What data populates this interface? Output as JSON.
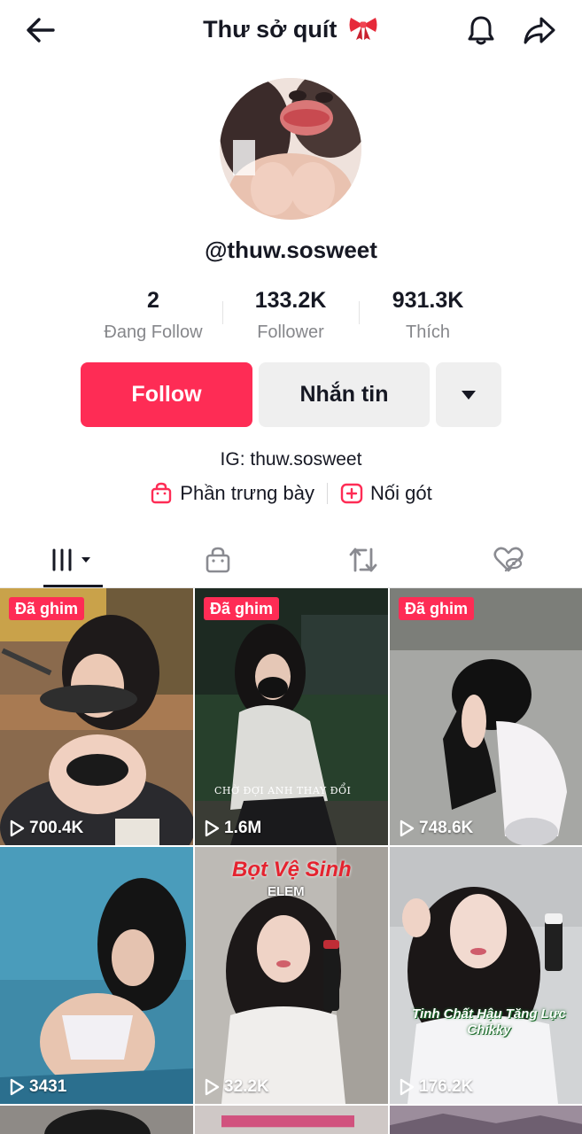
{
  "header": {
    "title": "Thư sở quít",
    "back_icon": "arrow-left-icon",
    "bell_icon": "bell-icon",
    "share_icon": "share-arrow-icon",
    "title_emoji": "ribbon-bow-icon"
  },
  "profile": {
    "username": "@thuw.sosweet",
    "stats": [
      {
        "value": "2",
        "label": "Đang Follow"
      },
      {
        "value": "133.2K",
        "label": "Follower"
      },
      {
        "value": "931.3K",
        "label": "Thích"
      }
    ],
    "follow_label": "Follow",
    "message_label": "Nhắn tin",
    "bio": "IG: thuw.sosweet",
    "links": [
      {
        "label": "Phần trưng bày",
        "icon": "shopping-bag-icon"
      },
      {
        "label": "Nối gót",
        "icon": "plus-square-icon"
      }
    ]
  },
  "tabs": [
    {
      "name": "videos",
      "icon": "grid-bars-icon",
      "active": true
    },
    {
      "name": "shop",
      "icon": "bag-icon",
      "active": false
    },
    {
      "name": "reposts",
      "icon": "repost-icon",
      "active": false
    },
    {
      "name": "liked",
      "icon": "heart-hidden-icon",
      "active": false
    }
  ],
  "videos": [
    {
      "pinned": "Đã ghim",
      "views": "700.4K"
    },
    {
      "pinned": "Đã ghim",
      "views": "1.6M",
      "caption": "CHỜ ĐỢI ANH THAY ĐỔI"
    },
    {
      "pinned": "Đã ghim",
      "views": "748.6K"
    },
    {
      "views": "3431"
    },
    {
      "views": "32.2K",
      "caption_top": "Bọt Vệ Sinh",
      "caption_sub": "ELEM"
    },
    {
      "views": "176.2K",
      "caption": "Tinh Chất Hậu Tăng Lực Chikky"
    }
  ],
  "colors": {
    "accent": "#fe2c55",
    "text": "#161823",
    "muted": "#86878b",
    "button_gray": "#efefef"
  }
}
